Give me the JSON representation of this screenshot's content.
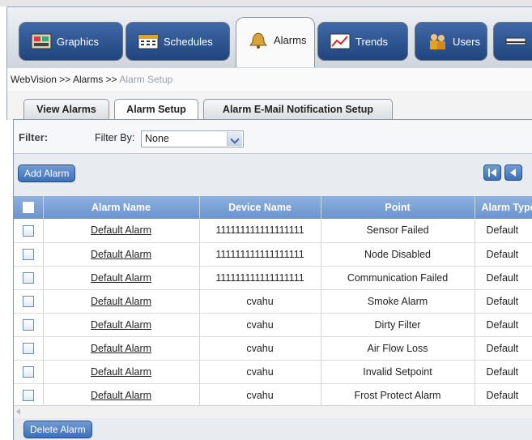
{
  "main_tabs": [
    {
      "label": "Graphics",
      "icon": "graphics-icon"
    },
    {
      "label": "Schedules",
      "icon": "calendar-icon"
    },
    {
      "label": "Alarms",
      "icon": "bell-icon"
    },
    {
      "label": "Trends",
      "icon": "trend-chart-icon"
    },
    {
      "label": "Users",
      "icon": "users-icon"
    },
    {
      "label": "",
      "icon": "device-icon"
    }
  ],
  "breadcrumb": {
    "path": "WebVision >> Alarms >> ",
    "current": "Alarm Setup"
  },
  "sub_tabs": [
    "View Alarms",
    "Alarm Setup",
    "Alarm E-Mail Notification Setup"
  ],
  "filter": {
    "label": "Filter:",
    "by_label": "Filter By:",
    "value": "None"
  },
  "buttons": {
    "add": "Add Alarm",
    "delete": "Delete Alarm"
  },
  "table": {
    "columns": [
      "",
      "Alarm Name",
      "Device Name",
      "Point",
      "Alarm Type"
    ],
    "rows": [
      [
        "Default Alarm",
        "111111111111111111",
        "Sensor Failed",
        "Default"
      ],
      [
        "Default Alarm",
        "111111111111111111",
        "Node Disabled",
        "Default"
      ],
      [
        "Default Alarm",
        "111111111111111111",
        "Communication Failed",
        "Default"
      ],
      [
        "Default Alarm",
        "cvahu",
        "Smoke Alarm",
        "Default"
      ],
      [
        "Default Alarm",
        "cvahu",
        "Dirty Filter",
        "Default"
      ],
      [
        "Default Alarm",
        "cvahu",
        "Air Flow Loss",
        "Default"
      ],
      [
        "Default Alarm",
        "cvahu",
        "Invalid Setpoint",
        "Default"
      ],
      [
        "Default Alarm",
        "cvahu",
        "Frost Protect Alarm",
        "Default"
      ]
    ]
  },
  "colors": {
    "accent": "#3e6fb6",
    "header": "#7ea3d6"
  }
}
